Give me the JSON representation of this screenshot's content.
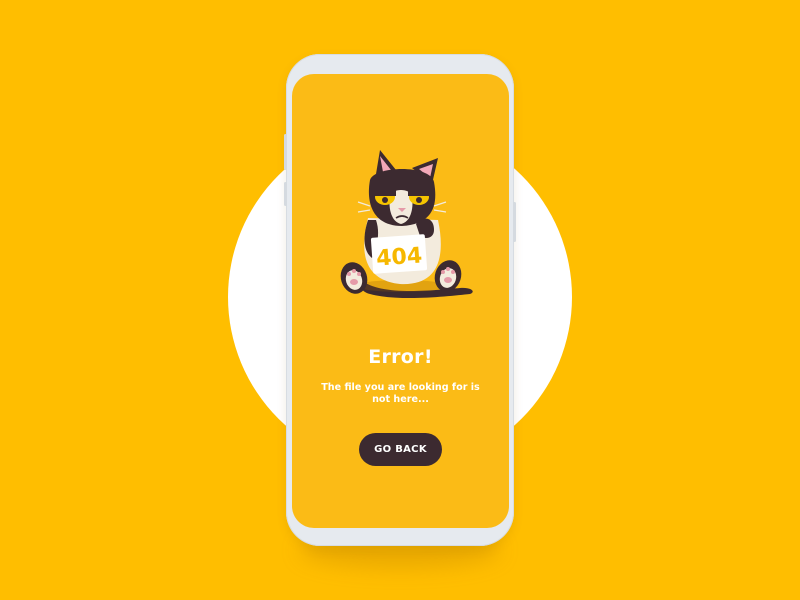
{
  "error_screen": {
    "badge_text": "404",
    "title": "Error!",
    "message": "The file you are looking for is not here...",
    "button_label": "GO BACK"
  },
  "icons": {
    "illustration": "grumpy-cat-404-illustration"
  },
  "colors": {
    "background": "#FFBE00",
    "screen": "#FBBB16",
    "button": "#3C2A30",
    "text": "#FFFFFF",
    "phone_frame": "#E6EAEF"
  }
}
